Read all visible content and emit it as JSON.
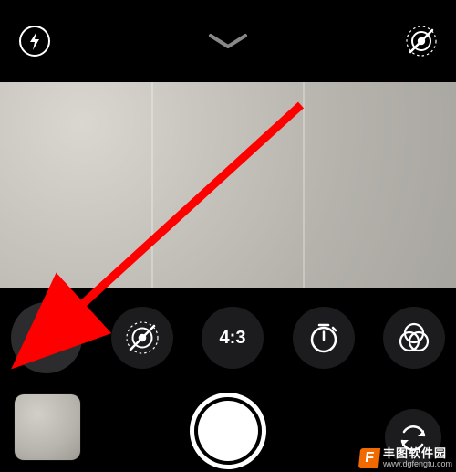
{
  "top": {
    "flash_icon": "flash-icon",
    "expand_icon": "chevron-down-icon",
    "live_off_icon": "live-photo-off-icon"
  },
  "controls": {
    "flash": {
      "icon": "flash-icon"
    },
    "live": {
      "icon": "live-photo-off-icon"
    },
    "ratio": {
      "label": "4:3"
    },
    "timer": {
      "icon": "timer-icon"
    },
    "filters": {
      "icon": "filters-icon"
    }
  },
  "bottom": {
    "thumbnail": "last-photo-thumbnail",
    "shutter": "shutter-button",
    "switch": "camera-switch-icon"
  },
  "annotation": {
    "type": "arrow",
    "color": "#ff0000",
    "target": "flash-control-button"
  },
  "watermark": {
    "badge_letter": "F",
    "title": "丰图软件园",
    "url": "www.dgfengtu.com"
  }
}
